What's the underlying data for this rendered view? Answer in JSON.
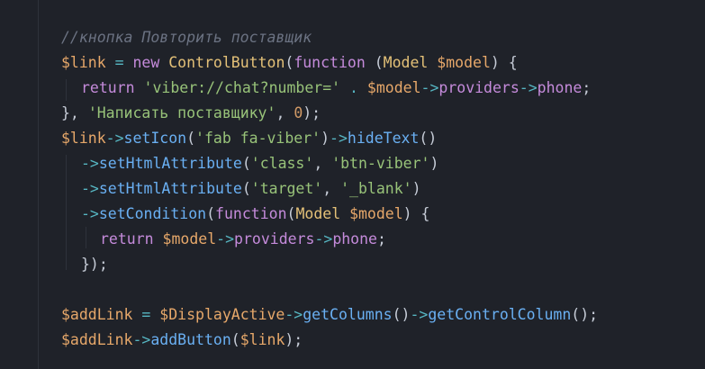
{
  "editor": {
    "lines": [
      [
        {
          "t": "//кнопка Повторить поставщик",
          "c": "comment"
        }
      ],
      [
        {
          "t": "$link",
          "c": "var"
        },
        {
          "t": " = ",
          "c": "op"
        },
        {
          "t": "new ",
          "c": "kw"
        },
        {
          "t": "ControlButton",
          "c": "cls"
        },
        {
          "t": "(",
          "c": "pl"
        },
        {
          "t": "function",
          "c": "kw"
        },
        {
          "t": " (",
          "c": "pl"
        },
        {
          "t": "Model",
          "c": "cls"
        },
        {
          "t": " ",
          "c": "pl"
        },
        {
          "t": "$model",
          "c": "var"
        },
        {
          "t": ") {",
          "c": "pl"
        }
      ],
      [
        {
          "t": "return ",
          "c": "kw"
        },
        {
          "t": "'viber://chat?number='",
          "c": "str"
        },
        {
          "t": " . ",
          "c": "op"
        },
        {
          "t": "$model",
          "c": "var"
        },
        {
          "t": "->",
          "c": "op"
        },
        {
          "t": "providers",
          "c": "kw"
        },
        {
          "t": "->",
          "c": "op"
        },
        {
          "t": "phone",
          "c": "kw"
        },
        {
          "t": ";",
          "c": "pl"
        }
      ],
      [
        {
          "t": "}, ",
          "c": "pl"
        },
        {
          "t": "'Написать поставщику'",
          "c": "str"
        },
        {
          "t": ", ",
          "c": "pl"
        },
        {
          "t": "0",
          "c": "num"
        },
        {
          "t": ");",
          "c": "pl"
        }
      ],
      [
        {
          "t": "$link",
          "c": "var"
        },
        {
          "t": "->",
          "c": "op"
        },
        {
          "t": "setIcon",
          "c": "fn"
        },
        {
          "t": "(",
          "c": "pl"
        },
        {
          "t": "'fab fa-viber'",
          "c": "str"
        },
        {
          "t": ")",
          "c": "pl"
        },
        {
          "t": "->",
          "c": "op"
        },
        {
          "t": "hideText",
          "c": "fn"
        },
        {
          "t": "()",
          "c": "pl"
        }
      ],
      [
        {
          "t": "->",
          "c": "op"
        },
        {
          "t": "setHtmlAttribute",
          "c": "fn"
        },
        {
          "t": "(",
          "c": "pl"
        },
        {
          "t": "'class'",
          "c": "str"
        },
        {
          "t": ", ",
          "c": "pl"
        },
        {
          "t": "'btn-viber'",
          "c": "str"
        },
        {
          "t": ")",
          "c": "pl"
        }
      ],
      [
        {
          "t": "->",
          "c": "op"
        },
        {
          "t": "setHtmlAttribute",
          "c": "fn"
        },
        {
          "t": "(",
          "c": "pl"
        },
        {
          "t": "'target'",
          "c": "str"
        },
        {
          "t": ", ",
          "c": "pl"
        },
        {
          "t": "'_blank'",
          "c": "str"
        },
        {
          "t": ")",
          "c": "pl"
        }
      ],
      [
        {
          "t": "->",
          "c": "op"
        },
        {
          "t": "setCondition",
          "c": "fn"
        },
        {
          "t": "(",
          "c": "pl"
        },
        {
          "t": "function",
          "c": "kw"
        },
        {
          "t": "(",
          "c": "pl"
        },
        {
          "t": "Model",
          "c": "cls"
        },
        {
          "t": " ",
          "c": "pl"
        },
        {
          "t": "$model",
          "c": "var"
        },
        {
          "t": ") {",
          "c": "pl"
        }
      ],
      [
        {
          "t": "return ",
          "c": "kw"
        },
        {
          "t": "$model",
          "c": "var"
        },
        {
          "t": "->",
          "c": "op"
        },
        {
          "t": "providers",
          "c": "kw"
        },
        {
          "t": "->",
          "c": "op"
        },
        {
          "t": "phone",
          "c": "kw"
        },
        {
          "t": ";",
          "c": "pl"
        }
      ],
      [
        {
          "t": "});",
          "c": "pl"
        }
      ],
      [],
      [
        {
          "t": "$addLink",
          "c": "var"
        },
        {
          "t": " = ",
          "c": "op"
        },
        {
          "t": "$DisplayActive",
          "c": "var"
        },
        {
          "t": "->",
          "c": "op"
        },
        {
          "t": "getColumns",
          "c": "fn"
        },
        {
          "t": "()",
          "c": "pl"
        },
        {
          "t": "->",
          "c": "op"
        },
        {
          "t": "getControlColumn",
          "c": "fn"
        },
        {
          "t": "();",
          "c": "pl"
        }
      ],
      [
        {
          "t": "$addLink",
          "c": "var"
        },
        {
          "t": "->",
          "c": "op"
        },
        {
          "t": "addButton",
          "c": "fn"
        },
        {
          "t": "(",
          "c": "pl"
        },
        {
          "t": "$link",
          "c": "var"
        },
        {
          "t": ");",
          "c": "pl"
        }
      ]
    ]
  }
}
